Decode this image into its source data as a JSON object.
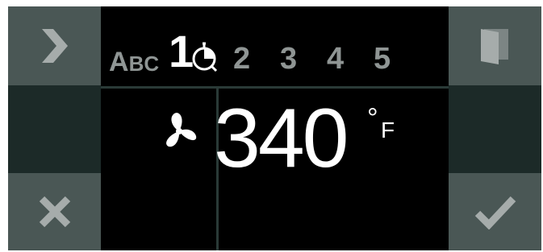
{
  "colors": {
    "side_button_bg": "#4a5755",
    "side_middle_bg": "#1c2a28",
    "icon_grey": "#a6acab",
    "display_bg": "#000000",
    "inactive_text": "#8f9594",
    "active_text": "#ffffff"
  },
  "left_panel": {
    "top_button_icon": "chevron-right-icon",
    "bottom_button_icon": "close-x-icon"
  },
  "right_panel": {
    "top_button_icon": "door-icon",
    "bottom_button_icon": "checkmark-icon"
  },
  "display": {
    "name_label_big": "A",
    "name_label_small": "BC",
    "active_step": "1",
    "timer_icon": "timer-icon",
    "steps": [
      "2",
      "3",
      "4",
      "5"
    ],
    "mode_icon": "fan-icon",
    "temperature": "340",
    "degree_symbol": "°",
    "unit": "F"
  }
}
